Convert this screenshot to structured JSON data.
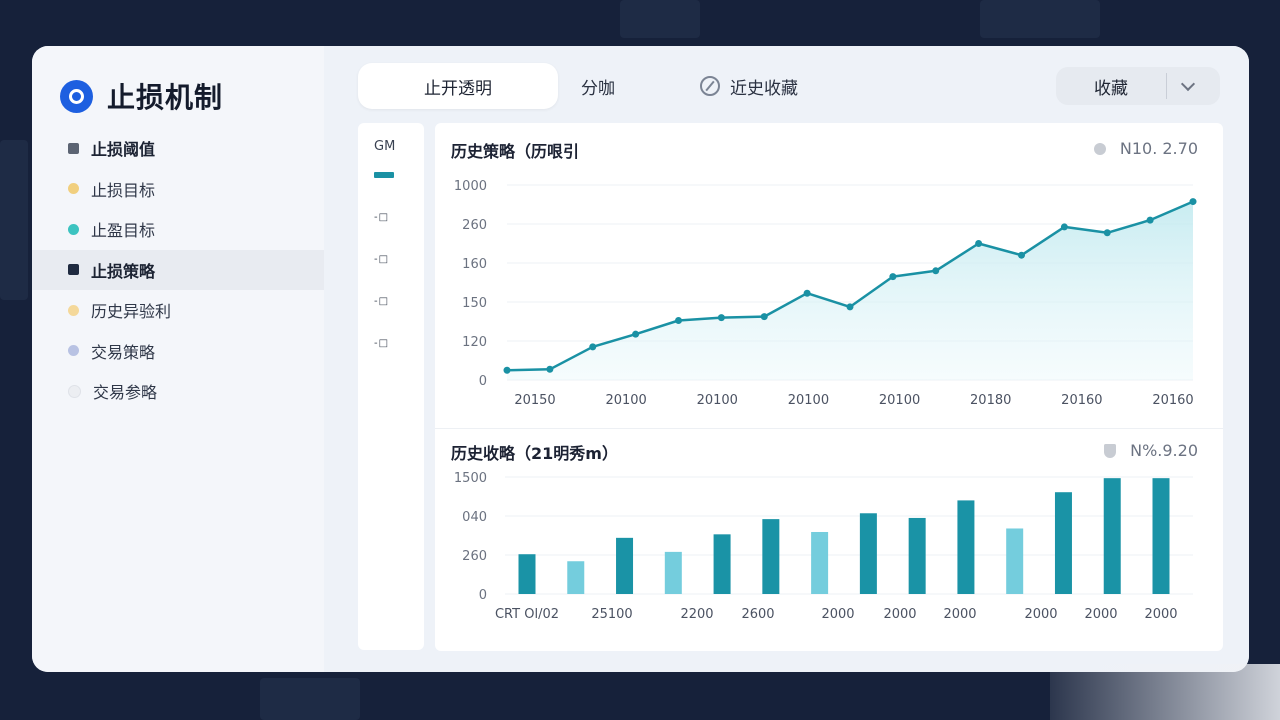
{
  "brand": {
    "title": "止损机制",
    "logo": "ring-logo-icon",
    "color": "#1d5fe0"
  },
  "sidebar": {
    "items": [
      {
        "label": "止损阈值",
        "dot_color": "#5c6473",
        "square": true,
        "bold": true,
        "active": false
      },
      {
        "label": "止损目标",
        "dot_color": "#f1cf7e",
        "square": false,
        "bold": false,
        "active": false
      },
      {
        "label": "止盈目标",
        "dot_color": "#3cc3c0",
        "square": false,
        "bold": false,
        "active": false
      },
      {
        "label": "止损策略",
        "dot_color": "#1f2a40",
        "square": true,
        "bold": true,
        "active": true
      },
      {
        "label": "历史异验利",
        "dot_color": "#f4d89a",
        "square": false,
        "bold": false,
        "active": false
      },
      {
        "label": "交易策略",
        "dot_color": "#b8c2e3",
        "square": false,
        "bold": false,
        "active": false
      },
      {
        "label": "交易参略",
        "dot_color": "#eceef2",
        "square": false,
        "bold": false,
        "active": false
      }
    ]
  },
  "tabs": [
    {
      "label": "止开透明",
      "active": true
    },
    {
      "label": "分咖",
      "active": false
    },
    {
      "label": "近史收藏",
      "active": false,
      "icon": "compass-icon"
    }
  ],
  "favorite": {
    "label": "收藏",
    "icon": "chevron-down-icon"
  },
  "mini_panel": {
    "label": "GM",
    "items": [
      "-□",
      "-□",
      "-□",
      "-□"
    ]
  },
  "chart_data": [
    {
      "type": "area",
      "title": "历史策略（历哏引",
      "stat": "N10. 2.70",
      "stat_icon": "dot-icon",
      "y_ticks": [
        "0",
        "120",
        "150",
        "160",
        "260",
        "1000"
      ],
      "x_labels": [
        "20150",
        "20100",
        "20100",
        "20100",
        "20100",
        "20180",
        "20160",
        "20160"
      ],
      "values": [
        0.05,
        0.055,
        0.17,
        0.235,
        0.305,
        0.32,
        0.325,
        0.445,
        0.375,
        0.53,
        0.56,
        0.7,
        0.64,
        0.785,
        0.755,
        0.82,
        0.915
      ],
      "series_color": "#1a91a4"
    },
    {
      "type": "bar",
      "title": "历史收略（21明秀m）",
      "stat": "N%.9.20",
      "stat_icon": "shield-icon",
      "y_ticks": [
        "0",
        "260",
        "040",
        "1500"
      ],
      "x_labels": [
        "CRT Ol/02",
        "25100",
        "2200",
        "2600",
        "2000",
        "2000",
        "2000",
        "2000",
        "2000",
        "2000"
      ],
      "values": [
        0.34,
        0.28,
        0.48,
        0.36,
        0.51,
        0.64,
        0.53,
        0.69,
        0.65,
        0.8,
        0.56,
        0.87,
        0.99,
        0.99
      ],
      "dark_color": "#1a93a6",
      "light_color": "#74cddd"
    }
  ]
}
